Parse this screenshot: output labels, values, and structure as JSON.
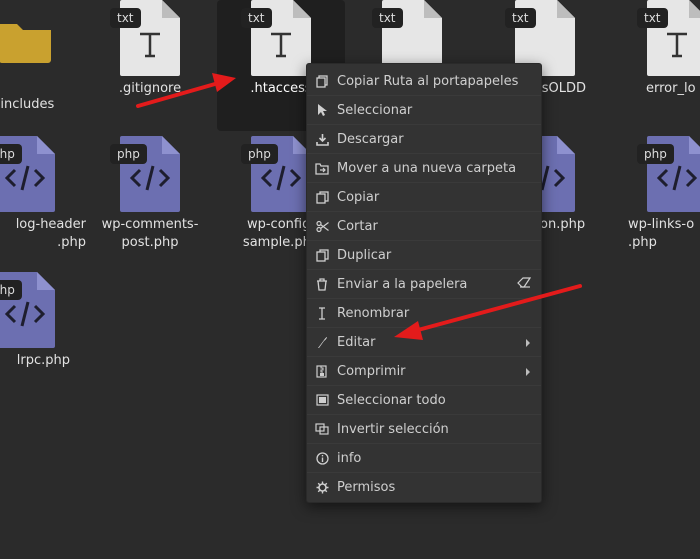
{
  "files": [
    {
      "name": "-includes",
      "type": "folder"
    },
    {
      "name": ".gitignore",
      "badge": "txt"
    },
    {
      "name": ".htaccess",
      "badge": "txt"
    },
    {
      "name": "ssOLDD",
      "badge": "txt"
    },
    {
      "name": "error_lo",
      "badge": "txt"
    },
    {
      "name": "log-header\n.php",
      "badge": "php"
    },
    {
      "name": "wp-comments-\npost.php",
      "badge": "php"
    },
    {
      "name": "wp-config-\nsample.php",
      "badge": "php"
    },
    {
      "name": "on.php",
      "badge": "php"
    },
    {
      "name": "wp-links-o\n.php",
      "badge": "php"
    },
    {
      "name": "lrpc.php",
      "badge": "php"
    }
  ],
  "context_menu": {
    "items": [
      {
        "label": "Copiar Ruta al portapapeles",
        "icon": "copy-path-icon"
      },
      {
        "label": "Seleccionar",
        "icon": "cursor-icon"
      },
      {
        "label": "Descargar",
        "icon": "download-icon"
      },
      {
        "label": "Mover a una nueva carpeta",
        "icon": "move-folder-icon"
      },
      {
        "label": "Copiar",
        "icon": "copy-icon"
      },
      {
        "label": "Cortar",
        "icon": "scissors-icon"
      },
      {
        "label": "Duplicar",
        "icon": "duplicate-icon"
      },
      {
        "label": "Enviar a la papelera",
        "icon": "trash-icon",
        "extra_icon": "eraser-icon"
      },
      {
        "label": "Renombrar",
        "icon": "text-cursor-icon"
      },
      {
        "label": "Editar",
        "icon": "feather-icon",
        "submenu": true
      },
      {
        "label": "Comprimir",
        "icon": "archive-icon",
        "submenu": true
      },
      {
        "label": "Seleccionar todo",
        "icon": "select-all-icon"
      },
      {
        "label": "Invertir selección",
        "icon": "invert-selection-icon"
      },
      {
        "label": "info",
        "icon": "info-icon"
      },
      {
        "label": "Permisos",
        "icon": "gear-icon"
      }
    ]
  },
  "colors": {
    "background": "#2b2b2b",
    "txt_doc": "#e6e6e6",
    "php_doc": "#6c6fb1",
    "folder": "#c9a12f",
    "annotation_arrow": "#e31b1b"
  }
}
